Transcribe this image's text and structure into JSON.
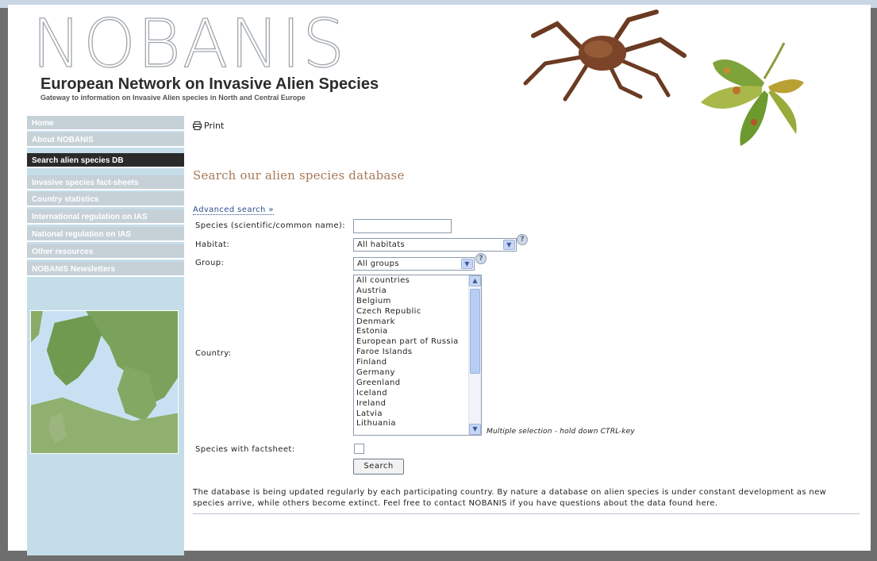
{
  "header": {
    "logo": "NOBANIS",
    "network_title": "European Network on Invasive Alien Species",
    "gateway": "Gateway to information on Invasive Alien species in North and Central Europe"
  },
  "sidebar": {
    "items": [
      {
        "label": "Home",
        "active": false
      },
      {
        "label": "About NOBANIS",
        "active": false
      },
      {
        "label": "Search alien species DB",
        "active": true
      },
      {
        "label": "Invasive species fact-sheets",
        "active": false
      },
      {
        "label": "Country statistics",
        "active": false
      },
      {
        "label": "International regulation on IAS",
        "active": false
      },
      {
        "label": "National regulation on IAS",
        "active": false
      },
      {
        "label": "Other resources",
        "active": false
      },
      {
        "label": "NOBANIS Newsletters",
        "active": false
      }
    ]
  },
  "main": {
    "print_label": "Print",
    "title": "Search our alien species database",
    "advanced_link": "Advanced search »",
    "form": {
      "species_label": "Species (scientific/common name):",
      "species_value": "",
      "habitat_label": "Habitat:",
      "habitat_selected": "All habitats",
      "group_label": "Group:",
      "group_selected": "All groups",
      "country_label": "Country:",
      "countries": [
        "All countries",
        "Austria",
        "Belgium",
        "Czech Republic",
        "Denmark",
        "Estonia",
        "European part of Russia",
        "Faroe Islands",
        "Finland",
        "Germany",
        "Greenland",
        "Iceland",
        "Ireland",
        "Latvia",
        "Lithuania"
      ],
      "multi_hint": "Multiple selection - hold down CTRL-key",
      "factsheet_label": "Species with factsheet:",
      "factsheet_checked": false,
      "search_button": "Search"
    },
    "footer_text": "The database is being updated regularly by each participating country. By nature a database on alien species is under constant development as new species arrive, while others become extinct. Feel free to contact NOBANIS if you have questions about the data found here."
  },
  "colors": {
    "sidebar_bg": "#c5dde9",
    "nav_item_bg": "#c6d0d7",
    "nav_active_bg": "#2a2a2a",
    "title_color": "#a7795a",
    "link_color": "#2a4d8a"
  }
}
